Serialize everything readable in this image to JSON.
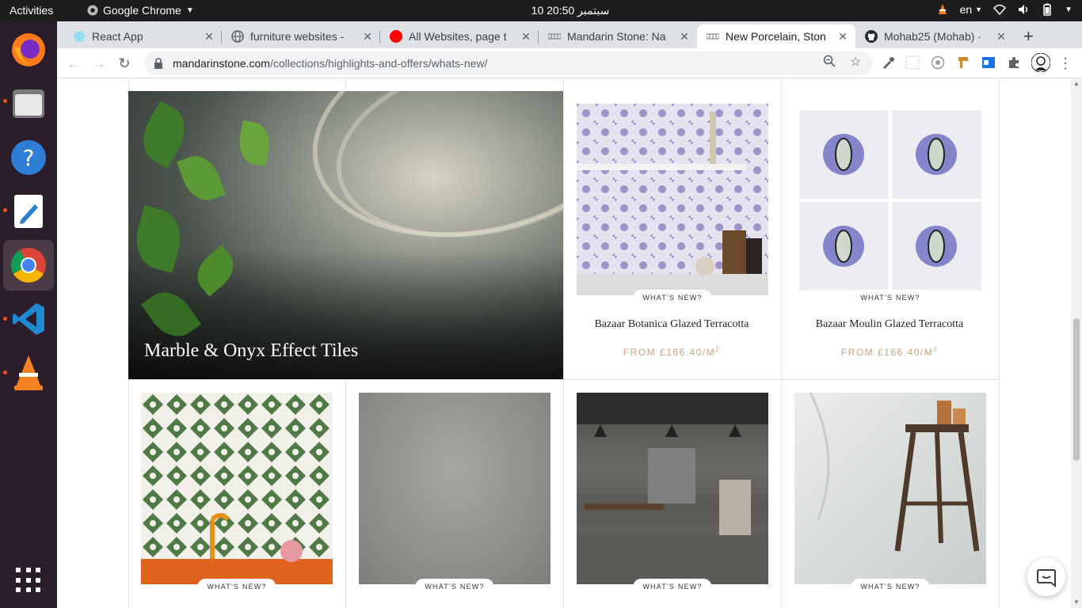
{
  "topbar": {
    "activities": "Activities",
    "app_name": "Google Chrome",
    "clock": "10 سبتمبر  20:50",
    "language": "en"
  },
  "dock": {
    "items": [
      "firefox-icon",
      "files-icon",
      "help-icon",
      "text-editor-icon",
      "chrome-icon",
      "vscode-icon",
      "vlc-icon",
      "show-apps-icon"
    ]
  },
  "browser": {
    "tabs": [
      {
        "title": "React App",
        "icon": "react-icon"
      },
      {
        "title": "furniture websites -",
        "icon": "globe-icon"
      },
      {
        "title": "All Websites, page t",
        "icon": "red-circle-icon"
      },
      {
        "title": "Mandarin Stone: Na",
        "icon": "mandarin-icon"
      },
      {
        "title": "New Porcelain, Ston",
        "icon": "mandarin-icon"
      },
      {
        "title": "Mohab25 (Mohab) ·",
        "icon": "github-icon"
      }
    ],
    "active_tab": 4,
    "url_domain": "mandarinstone.com",
    "url_path": "/collections/highlights-and-offers/whats-new/"
  },
  "page": {
    "hero_title": "Marble & Onyx Effect Tiles",
    "products": [
      {
        "badge": "WHAT'S NEW?",
        "name": "Bazaar Botanica Glazed Terracotta",
        "price": "FROM £166.40/M",
        "unit_sup": "2"
      },
      {
        "badge": "WHAT'S NEW?",
        "name": "Bazaar Moulin Glazed Terracotta",
        "price": "FROM £166.40/M",
        "unit_sup": "2"
      },
      {
        "badge": "WHAT'S NEW?"
      },
      {
        "badge": "WHAT'S NEW?"
      },
      {
        "badge": "WHAT'S NEW?"
      },
      {
        "badge": "WHAT'S NEW?"
      }
    ]
  },
  "colors": {
    "price": "#c9a27e",
    "dock_bg": "#2c1d2a",
    "topbar_bg": "#1d1d1d",
    "accent_dot": "#e95420"
  }
}
